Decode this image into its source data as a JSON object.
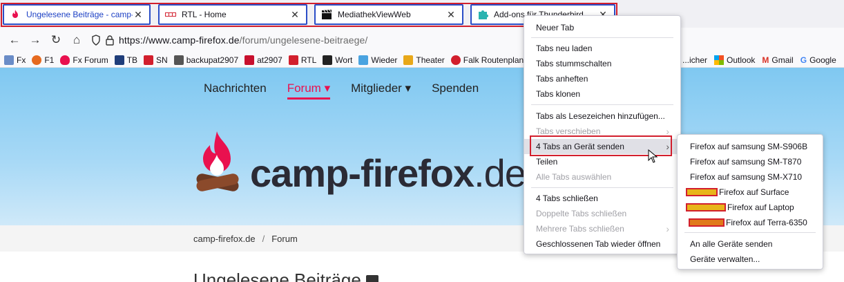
{
  "tabs": [
    {
      "title": "Ungelesene Beiträge - camp-firefox.de",
      "active": true
    },
    {
      "title": "RTL - Home",
      "active": false
    },
    {
      "title": "MediathekViewWeb",
      "active": false
    },
    {
      "title": "Add-ons für Thunderbird",
      "active": false
    }
  ],
  "navbar": {
    "url_host": "https://www.camp-firefox.de",
    "url_path": "/forum/ungelesene-beitraege/"
  },
  "bookmarks": [
    "Fx",
    "F1",
    "Fx Forum",
    "TB",
    "SN",
    "backupat2907",
    "at2907",
    "RTL",
    "Wort",
    "Wieder",
    "Theater",
    "Falk Routenplaner"
  ],
  "bookmarks_right": [
    "...icher",
    "Outlook",
    "Gmail",
    "Google"
  ],
  "site": {
    "menu": [
      "Nachrichten",
      "Forum",
      "Mitglieder",
      "Spenden"
    ],
    "logo_main": "camp-firefox",
    "logo_tld": ".de",
    "breadcrumb": [
      "camp-firefox.de",
      "Forum"
    ],
    "heading": "Ungelesene Beiträge"
  },
  "context_menu": {
    "items": [
      {
        "label": "Neuer Tab",
        "disabled": false
      },
      {
        "label": "Tabs neu laden",
        "disabled": false
      },
      {
        "label": "Tabs stummschalten",
        "disabled": false
      },
      {
        "label": "Tabs anheften",
        "disabled": false
      },
      {
        "label": "Tabs klonen",
        "disabled": false
      },
      {
        "label": "Tabs als Lesezeichen hinzufügen...",
        "disabled": false
      },
      {
        "label": "Tabs verschieben",
        "disabled": true
      },
      {
        "label": "4 Tabs an Gerät senden",
        "disabled": false
      },
      {
        "label": "Teilen",
        "disabled": false
      },
      {
        "label": "Alle Tabs auswählen",
        "disabled": true
      },
      {
        "label": "4 Tabs schließen",
        "disabled": false
      },
      {
        "label": "Doppelte Tabs schließen",
        "disabled": true
      },
      {
        "label": "Mehrere Tabs schließen",
        "disabled": true
      },
      {
        "label": "Geschlossenen Tab wieder öffnen",
        "disabled": false
      }
    ]
  },
  "send_submenu": {
    "devices": [
      "Firefox auf samsung SM-S906B",
      "Firefox auf samsung SM-T870",
      "Firefox auf samsung SM-X710",
      "Firefox auf Surface",
      "Firefox auf Laptop",
      "Firefox auf Terra-6350"
    ],
    "send_all": "An alle Geräte senden",
    "manage": "Geräte verwalten..."
  },
  "colors": {
    "accent": "#e9114f",
    "highlight_box": "#d21f2d",
    "active_tab_border": "#2a4dc7"
  }
}
